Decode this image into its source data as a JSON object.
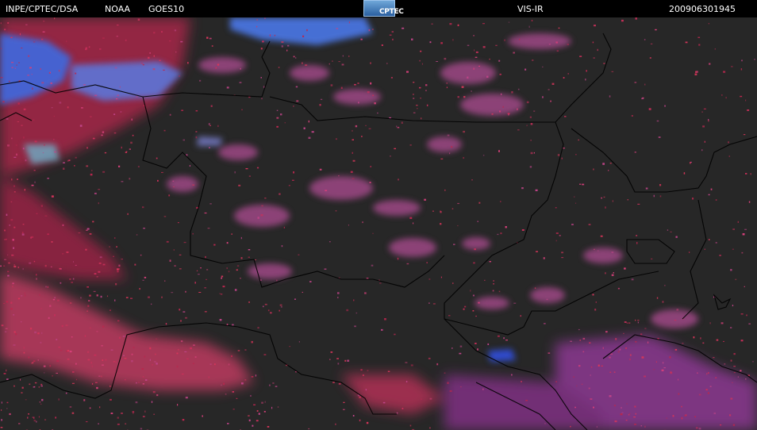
{
  "header": {
    "agency": "INPE/CPTEC/DSA",
    "org": "NOAA",
    "satellite": "GOES10",
    "channel": "VIS-IR",
    "timestamp": "200906301945",
    "logo_text": "CPTEC"
  },
  "colors": {
    "background": "#000000",
    "ground": "#272727",
    "low_cloud": "#d8365a",
    "mid_cloud": "#b84a9a",
    "high_cloud": "#4a78e8",
    "border_line": "#000000"
  },
  "icons": {
    "logo": "cptec-logo"
  }
}
